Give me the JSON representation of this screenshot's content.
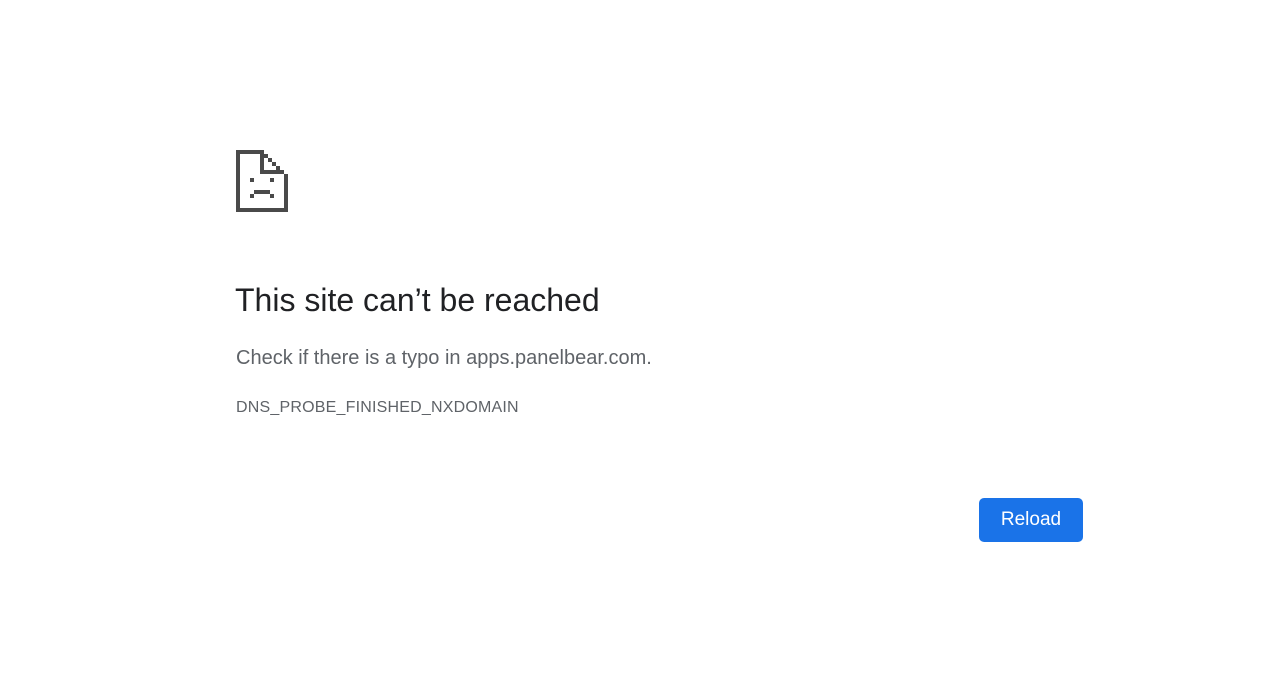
{
  "error": {
    "icon": "sad-page-icon",
    "title": "This site can’t be reached",
    "suggestion": "Check if there is a typo in apps.panelbear.com.",
    "code": "DNS_PROBE_FINISHED_NXDOMAIN"
  },
  "actions": {
    "reload_label": "Reload"
  },
  "colors": {
    "background": "#ffffff",
    "title": "#202124",
    "secondary_text": "#5f6368",
    "icon": "#4a4a4a",
    "button": "#1a73e8",
    "button_text": "#ffffff"
  }
}
